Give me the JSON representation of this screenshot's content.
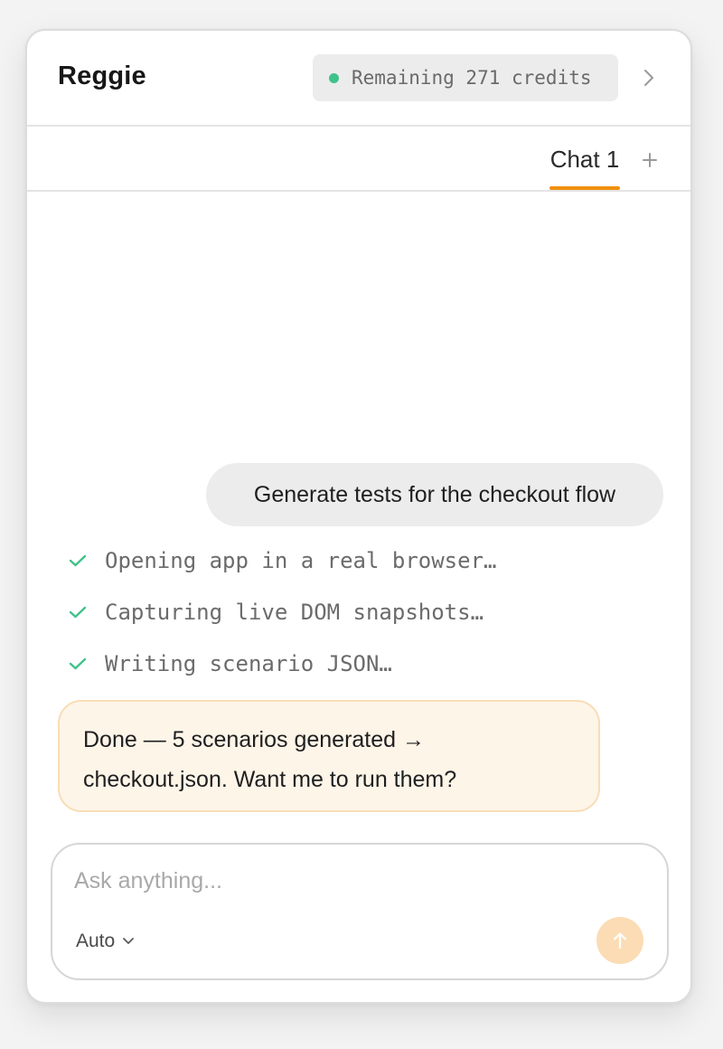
{
  "header": {
    "title": "Reggie",
    "credits_text": "Remaining 271 credits",
    "credits_status_color": "#3fc28a",
    "expand_icon": "chevron-right-icon"
  },
  "tabs": {
    "items": [
      {
        "label": "Chat 1",
        "active": true
      }
    ],
    "active_color": "#f0900a",
    "add_icon": "plus-icon"
  },
  "conversation": {
    "user_message": "Generate tests for the checkout flow",
    "steps": [
      {
        "text": "Opening app in a real browser…",
        "status": "done",
        "icon": "check-icon"
      },
      {
        "text": "Capturing live DOM snapshots…",
        "status": "done",
        "icon": "check-icon"
      },
      {
        "text": "Writing scenario JSON…",
        "status": "done",
        "icon": "check-icon"
      }
    ],
    "assistant_message": {
      "line1": "Done — 5 scenarios generated →",
      "line2": "checkout.json. Want me to run them?"
    }
  },
  "composer": {
    "placeholder": "Ask anything...",
    "value": "",
    "model_label": "Auto",
    "model_icon": "chevron-down-icon",
    "send_icon": "arrow-up-icon",
    "send_color": "#fbdcb4"
  }
}
